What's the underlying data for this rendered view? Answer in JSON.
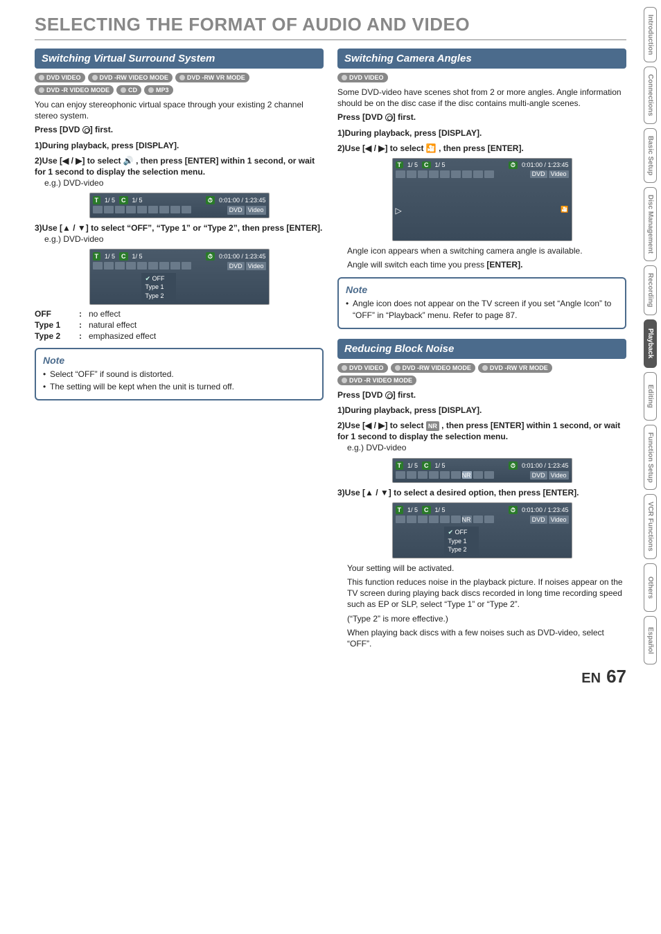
{
  "page_title": "SELECTING THE FORMAT OF AUDIO AND VIDEO",
  "left": {
    "section1_title": "Switching Virtual Surround System",
    "badges": [
      "DVD VIDEO",
      "DVD -RW VIDEO MODE",
      "DVD -RW VR MODE",
      "DVD -R VIDEO MODE",
      "CD",
      "MP3"
    ],
    "intro": "You can enjoy stereophonic virtual space through your existing 2 channel stereo system.",
    "press_first": "Press [DVD ⦿] first.",
    "step1": "During playback, press [DISPLAY].",
    "step2": "Use [◀ / ▶] to select 🔊 , then press [ENTER] within 1 second, or wait for 1 second to display the selection menu.",
    "eg": "e.g.) DVD-video",
    "osd_display1": {
      "t": "T",
      "c": "C",
      "title": "1/  5",
      "chap": "1/  5",
      "time": "0:01:00 / 1:23:45",
      "dvd": "DVD",
      "video": "Video"
    },
    "step3": "Use [▲ / ▼] to select “OFF”, “Type 1” or “Type 2”, then press [ENTER].",
    "menu_items": [
      "OFF",
      "Type 1",
      "Type 2"
    ],
    "defs": [
      {
        "t": "OFF",
        "d": "no effect"
      },
      {
        "t": "Type 1",
        "d": "natural effect"
      },
      {
        "t": "Type 2",
        "d": "emphasized effect"
      }
    ],
    "note_title": "Note",
    "notes": [
      "Select “OFF” if sound is distorted.",
      "The setting will be kept when the unit is turned off."
    ]
  },
  "right": {
    "section1_title": "Switching Camera Angles",
    "badges1": [
      "DVD VIDEO"
    ],
    "intro1": "Some DVD-video have scenes shot from 2 or more angles. Angle information should be on the disc case if the disc contains multi-angle scenes.",
    "press_first": "Press [DVD ⦿] first.",
    "step1": "During playback, press [DISPLAY].",
    "step2": "Use [◀ / ▶] to select 🎦 , then press [ENTER].",
    "osd_angle": {
      "play": "▷",
      "angle": "🎦"
    },
    "angle_text1": "Angle icon appears when a switching camera angle is available.",
    "angle_text2": "Angle will switch each time you press [ENTER].",
    "note_title": "Note",
    "notes1": [
      "Angle icon does not appear on the TV screen if you set “Angle Icon” to “OFF” in “Playback” menu. Refer to page 87."
    ],
    "section2_title": "Reducing Block Noise",
    "badges2": [
      "DVD VIDEO",
      "DVD -RW VIDEO MODE",
      "DVD -RW VR MODE",
      "DVD -R VIDEO MODE"
    ],
    "r_step1": "During playback, press [DISPLAY].",
    "r_step2": "Use [◀ / ▶] to select NR , then press [ENTER] within 1 second, or wait for 1 second to display the selection menu.",
    "eg": "e.g.) DVD-video",
    "r_step3": "Use [▲ / ▼] to select a desired option, then press [ENTER].",
    "menu_items": [
      "OFF",
      "Type 1",
      "Type 2"
    ],
    "r_res1": "Your setting will be activated.",
    "r_res2": "This function reduces noise in the playback picture. If noises appear on the TV screen during playing back discs recorded in long time recording speed such as EP or SLP, select “Type 1” or “Type 2”.",
    "r_res3": "(“Type 2” is more effective.)",
    "r_res4": "When playing back discs with a few noises such as DVD-video, select “OFF”."
  },
  "tabs": [
    "Introduction",
    "Connections",
    "Basic Setup",
    "Disc Management",
    "Recording",
    "Playback",
    "Editing",
    "Function Setup",
    "VCR Functions",
    "Others",
    "Español"
  ],
  "active_tab": "Playback",
  "footer": {
    "lang": "EN",
    "page": "67"
  },
  "step_labels": {
    "s1": "1)",
    "s2": "2)",
    "s3": "3)"
  },
  "colon": ":"
}
